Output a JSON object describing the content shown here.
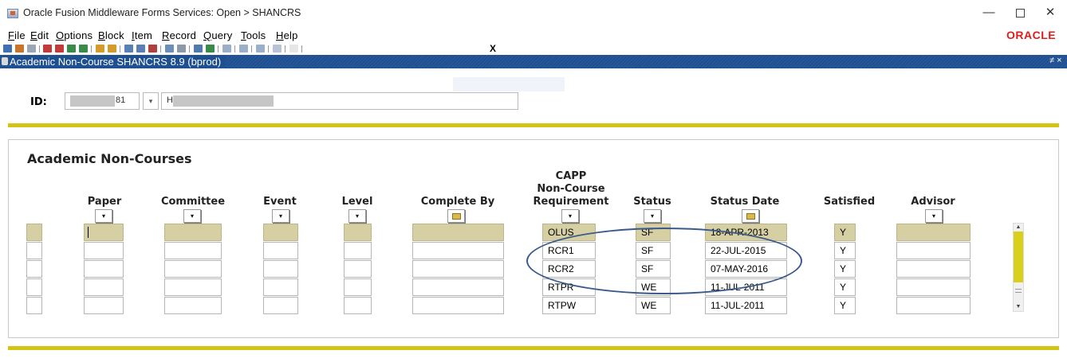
{
  "window": {
    "title": "Oracle Fusion Middleware Forms Services:  Open > SHANCRS",
    "minimize_glyph": "—",
    "close_glyph": "✕",
    "icon": "java-cup-icon"
  },
  "menu": {
    "items": [
      {
        "label": "File"
      },
      {
        "label": "Edit"
      },
      {
        "label": "Options"
      },
      {
        "label": "Block"
      },
      {
        "label": "Item"
      },
      {
        "label": "Record"
      },
      {
        "label": "Query"
      },
      {
        "label": "Tools"
      },
      {
        "label": "Help"
      }
    ],
    "logo": "ORACLE"
  },
  "toolbar": {
    "exit_glyph": "X"
  },
  "form": {
    "title": "Academic Non-Course  SHANCRS  8.9  (bprod)",
    "controls": "≠ ×"
  },
  "key_block": {
    "id_label": "ID:",
    "id_value": "81",
    "id_lov_glyph": "▾",
    "name_value": "H"
  },
  "section": {
    "title": "Academic Non-Courses"
  },
  "columns": {
    "paper": "Paper",
    "committee": "Committee",
    "event": "Event",
    "level": "Level",
    "complete_by": "Complete By",
    "requirement_line1": "CAPP",
    "requirement_line2": "Non-Course",
    "requirement_line3": "Requirement",
    "status": "Status",
    "status_date": "Status Date",
    "satisfied": "Satisfied",
    "advisor": "Advisor",
    "dropdown_glyph": "▾"
  },
  "rows": [
    {
      "requirement": "OLUS",
      "status": "SF",
      "status_date": "18-APR-2013",
      "satisfied": "Y"
    },
    {
      "requirement": "RCR1",
      "status": "SF",
      "status_date": "22-JUL-2015",
      "satisfied": "Y"
    },
    {
      "requirement": "RCR2",
      "status": "SF",
      "status_date": "07-MAY-2016",
      "satisfied": "Y"
    },
    {
      "requirement": "RTPR",
      "status": "WE",
      "status_date": "11-JUL-2011",
      "satisfied": "Y"
    },
    {
      "requirement": "RTPW",
      "status": "WE",
      "status_date": "11-JUL-2011",
      "satisfied": "Y"
    }
  ],
  "colors": {
    "accent_gold": "#d4c417",
    "active_row": "#d6cfa3",
    "form_titlebar": "#1e4f91",
    "oracle_red": "#e11c1c"
  }
}
